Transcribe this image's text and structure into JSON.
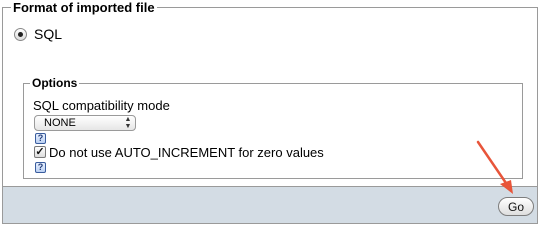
{
  "import_format": {
    "legend": "Format of imported file",
    "selected_format": "SQL"
  },
  "options": {
    "legend": "Options",
    "compat_label": "SQL compatibility mode",
    "compat_value": "NONE",
    "help_icon_label": "?",
    "checkbox_label": "Do not use AUTO_INCREMENT for zero values",
    "checkbox_checked": true
  },
  "footer": {
    "go_label": "Go"
  },
  "annotation": {
    "arrow_color": "#e8553a",
    "target": "go-button"
  }
}
